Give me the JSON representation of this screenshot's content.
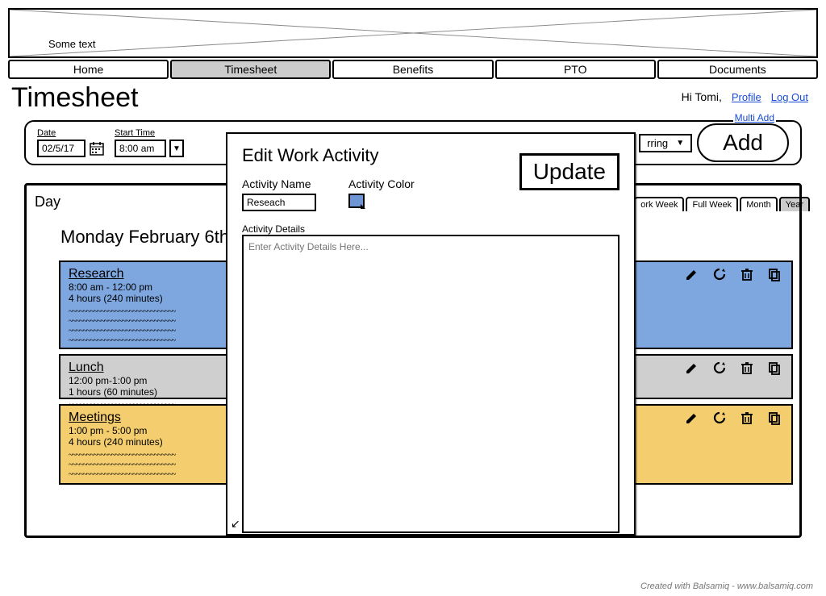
{
  "banner": {
    "text": "Some text"
  },
  "nav": {
    "tabs": [
      "Home",
      "Timesheet",
      "Benefits",
      "PTO",
      "Documents"
    ],
    "active": "Timesheet"
  },
  "page_title": "Timesheet",
  "greeting": "Hi Tomi,",
  "profile_link": "Profile",
  "logout_link": "Log Out",
  "toolbar": {
    "date_label": "Date",
    "date_value": "02/5/17",
    "start_label": "Start Time",
    "start_value": "8:00 am",
    "recurring_label": "rring",
    "multi_add": "Multi Add",
    "add_label": "Add"
  },
  "view_tabs": {
    "items": [
      "ork Week",
      "Full Week",
      "Month",
      "Year"
    ],
    "active": "Year"
  },
  "day": {
    "panel_title": "Day",
    "heading": "Monday February 6th",
    "entries": [
      {
        "title": "Research",
        "time": "8:00 am - 12:00 pm",
        "duration": "4 hours (240 minutes)"
      },
      {
        "title": "Lunch",
        "time": "12:00 pm-1:00 pm",
        "duration": "1 hours (60 minutes)"
      },
      {
        "title": "Meetings",
        "time": "1:00 pm - 5:00 pm",
        "duration": "4 hours (240 minutes)"
      }
    ]
  },
  "modal": {
    "title": "Edit Work Activity",
    "name_label": "Activity Name",
    "name_value": "Reseach",
    "color_label": "Activity Color",
    "details_label": "Activity Details",
    "details_placeholder": "Enter Activity Details Here...",
    "update_label": "Update"
  },
  "footer": "Created with Balsamiq - www.balsamiq.com"
}
